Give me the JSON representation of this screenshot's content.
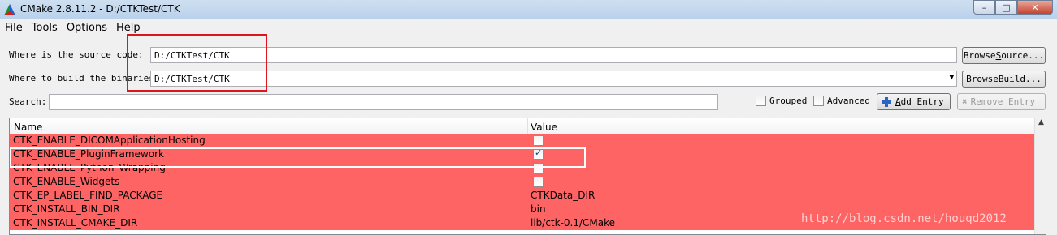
{
  "window": {
    "title": "CMake 2.8.11.2 - D:/CTKTest/CTK",
    "minimize_label": "–",
    "maximize_label": "□",
    "close_label": "✕"
  },
  "menu": [
    {
      "underline": "F",
      "rest": "ile"
    },
    {
      "underline": "T",
      "rest": "ools"
    },
    {
      "underline": "O",
      "rest": "ptions"
    },
    {
      "underline": "H",
      "rest": "elp"
    }
  ],
  "source": {
    "label": "Where is the source code:",
    "value": "D:/CTKTest/CTK",
    "browse_label_pre": "Browse ",
    "browse_label_u": "S",
    "browse_label_post": "ource..."
  },
  "build": {
    "label": "Where to build the binaries:",
    "value": "D:/CTKTest/CTK",
    "browse_label_pre": "Browse ",
    "browse_label_u": "B",
    "browse_label_post": "uild..."
  },
  "search": {
    "label": "Search:",
    "value": ""
  },
  "options": {
    "grouped_label": "Grouped",
    "grouped_checked": false,
    "advanced_label": "Advanced",
    "advanced_checked": false,
    "add_entry_u": "A",
    "add_entry_rest": "dd Entry",
    "remove_entry_label": "Remove Entry"
  },
  "table": {
    "headers": [
      "Name",
      "Value"
    ],
    "rows": [
      {
        "name": "CTK_ENABLE_DICOMApplicationHosting",
        "type": "bool",
        "checked": false,
        "value": ""
      },
      {
        "name": "CTK_ENABLE_PluginFramework",
        "type": "bool",
        "checked": true,
        "value": ""
      },
      {
        "name": "CTK_ENABLE_Python_Wrapping",
        "type": "bool",
        "checked": false,
        "value": ""
      },
      {
        "name": "CTK_ENABLE_Widgets",
        "type": "bool",
        "checked": false,
        "value": ""
      },
      {
        "name": "CTK_EP_LABEL_FIND_PACKAGE",
        "type": "text",
        "checked": false,
        "value": "CTKData_DIR"
      },
      {
        "name": "CTK_INSTALL_BIN_DIR",
        "type": "text",
        "checked": false,
        "value": "bin"
      },
      {
        "name": "CTK_INSTALL_CMAKE_DIR",
        "type": "text",
        "checked": false,
        "value": "lib/ctk-0.1/CMake"
      }
    ],
    "row_color": "#ff6464"
  },
  "watermark": "http://blog.csdn.net/houqd2012",
  "colors": {
    "annotation_red": "#e0141b",
    "annotation_white": "#ffffff"
  }
}
